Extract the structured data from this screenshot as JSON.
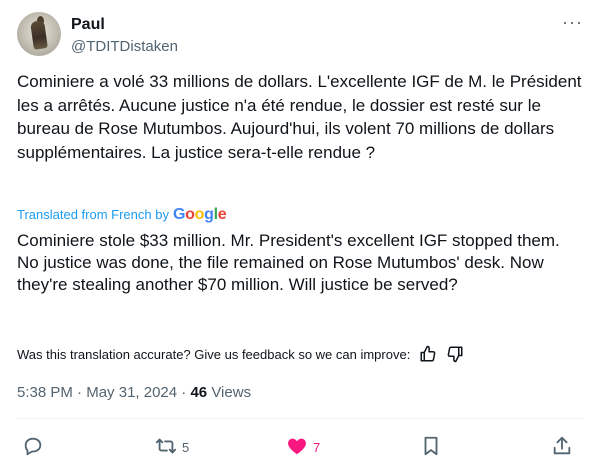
{
  "author": {
    "name": "Paul",
    "handle": "@TDITDistaken",
    "more_icon": "more-horizontal-icon"
  },
  "tweet": {
    "original_text": "Cominiere a volé 33 millions de dollars.  L'excellente IGF de M. le Président les a arrêtés.  Aucune justice n'a été rendue, le dossier est resté sur le bureau de Rose Mutumbos.  Aujourd'hui, ils volent 70 millions de dollars supplémentaires.  La justice sera-t-elle rendue ?",
    "translated_from": "Translated from French by",
    "translator_logo": "Google",
    "translated_text": "Cominiere stole $33 million. Mr. President's excellent IGF stopped them. No justice was done, the file remained on Rose Mutumbos' desk. Now they're stealing another $70 million. Will justice be served?"
  },
  "feedback": {
    "prompt": "Was this translation accurate? Give us feedback so we can improve:"
  },
  "meta": {
    "time": "5:38 PM",
    "separator1": " · ",
    "date": "May 31, 2024",
    "separator2": " · ",
    "views_count": "46",
    "views_label": " Views"
  },
  "actions": {
    "reply_count": "",
    "retweet_count": "5",
    "like_count": "7",
    "like_color": "#f91880",
    "muted_color": "#536471",
    "accent_color": "#1d9bf0"
  }
}
